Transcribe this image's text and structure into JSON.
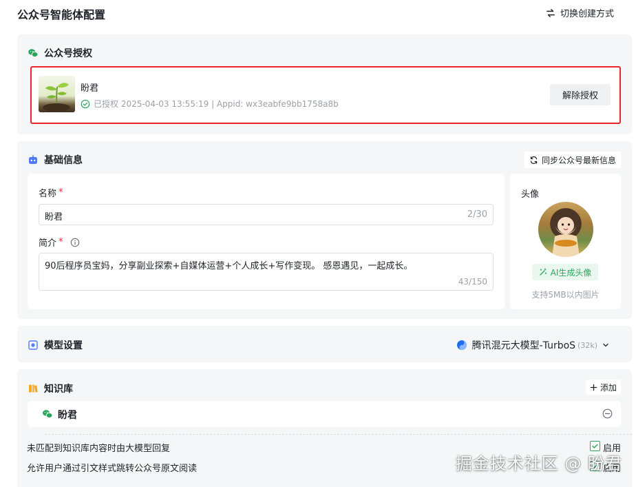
{
  "page": {
    "title": "公众号智能体配置",
    "switch_label": "切换创建方式"
  },
  "auth": {
    "title": "公众号授权",
    "account_name": "盼君",
    "meta": "已授权 2025-04-03 13:55:19 | Appid: wx3eabfe9bb1758a8b",
    "unbind_label": "解除授权"
  },
  "basic": {
    "title": "基础信息",
    "sync_label": "同步公众号最新信息",
    "name_label": "名称",
    "name_value": "盼君",
    "name_count": "2/30",
    "desc_label": "简介",
    "desc_value": "90后程序员宝妈，分享副业探索+自媒体运营+个人成长+写作变现。 感恩遇见，一起成长。",
    "desc_count": "43/150",
    "required_mark": "*",
    "avatar_label": "头像",
    "ai_avatar_label": "AI生成头像",
    "avatar_hint": "支持5MB以内图片"
  },
  "model": {
    "title": "模型设置",
    "selected": "腾讯混元大模型-TurboS",
    "context": "(32k)"
  },
  "knowledge": {
    "title": "知识库",
    "add_label": "添加",
    "items": [
      {
        "name": "盼君"
      }
    ],
    "options": [
      {
        "label": "未匹配到知识库内容时由大模型回复",
        "checked": true,
        "check_label": "启用"
      },
      {
        "label": "允许用户通过引文样式跳转公众号原文阅读",
        "checked": true,
        "check_label": "启用"
      }
    ]
  },
  "watermark": "掘金技术社区 @ 盼君",
  "colors": {
    "accent_green": "#2aa55c",
    "highlight_red": "#e8262b",
    "card_bg": "#f5f6f7",
    "robot_blue": "#4d7cfe"
  }
}
